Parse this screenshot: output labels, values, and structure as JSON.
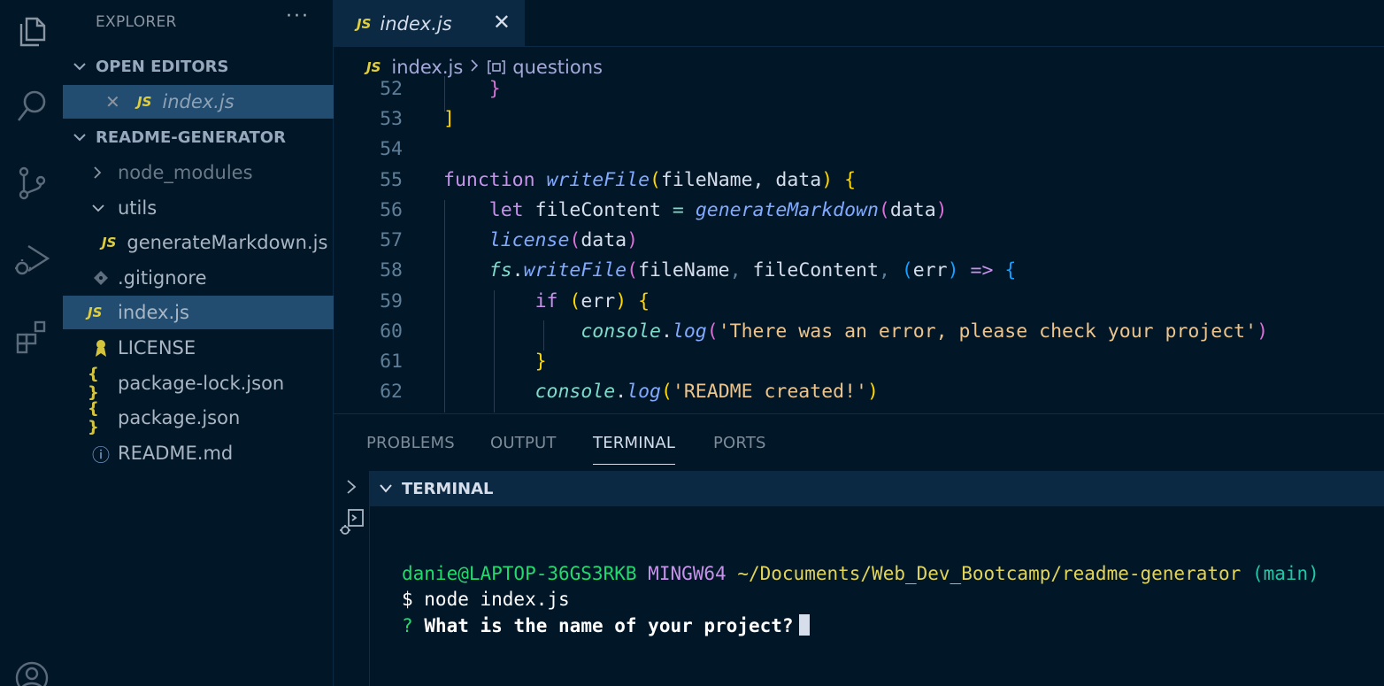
{
  "activity_bar": {
    "items": [
      {
        "icon": "files-icon"
      },
      {
        "icon": "search-icon"
      },
      {
        "icon": "source-control-icon"
      },
      {
        "icon": "run-debug-icon"
      },
      {
        "icon": "extensions-icon"
      },
      {
        "icon": "account-icon"
      }
    ]
  },
  "sidebar": {
    "title": "EXPLORER",
    "more": "···",
    "open_editors": {
      "label": "OPEN EDITORS",
      "items": [
        {
          "badge": "JS",
          "name": "index.js"
        }
      ]
    },
    "project": {
      "label": "README-GENERATOR",
      "items": [
        {
          "name": "node_modules",
          "type": "folder",
          "expanded": false
        },
        {
          "name": "utils",
          "type": "folder",
          "expanded": true
        },
        {
          "name": "generateMarkdown.js",
          "type": "js",
          "badge": "JS"
        },
        {
          "name": ".gitignore",
          "type": "git"
        },
        {
          "name": "index.js",
          "type": "js",
          "badge": "JS",
          "selected": true
        },
        {
          "name": "LICENSE",
          "type": "license"
        },
        {
          "name": "package-lock.json",
          "type": "json",
          "badge": "{ }"
        },
        {
          "name": "package.json",
          "type": "json",
          "badge": "{ }"
        },
        {
          "name": "README.md",
          "type": "info",
          "badge": "ⓘ"
        }
      ]
    }
  },
  "editor": {
    "tab": {
      "badge": "JS",
      "label": "index.js",
      "close": "✕"
    },
    "breadcrumb": {
      "file_badge": "JS",
      "file": "index.js",
      "symbol": "questions"
    },
    "line_numbers": [
      "52",
      "53",
      "54",
      "55",
      "56",
      "57",
      "58",
      "59",
      "60",
      "61",
      "62"
    ]
  },
  "panel": {
    "tabs": [
      "PROBLEMS",
      "OUTPUT",
      "TERMINAL",
      "PORTS"
    ],
    "active_tab": "TERMINAL",
    "terminal_header": "TERMINAL",
    "terminal": {
      "user_host": "danie@LAPTOP-36GS3RKB",
      "shell": "MINGW64",
      "path": "~/Documents/Web_Dev_Bootcamp/readme-generator",
      "branch": "(main)",
      "command": "$ node index.js",
      "prompt_mark": "?",
      "prompt_text": "What is the name of your project?"
    }
  },
  "colors": {
    "background": "#011627",
    "sidebar_selected": "#234d70",
    "js_badge": "#e0ce3c",
    "keyword": "#c792ea",
    "function": "#82aaff",
    "string": "#ecc48d",
    "terminal_green": "#22da6e"
  }
}
